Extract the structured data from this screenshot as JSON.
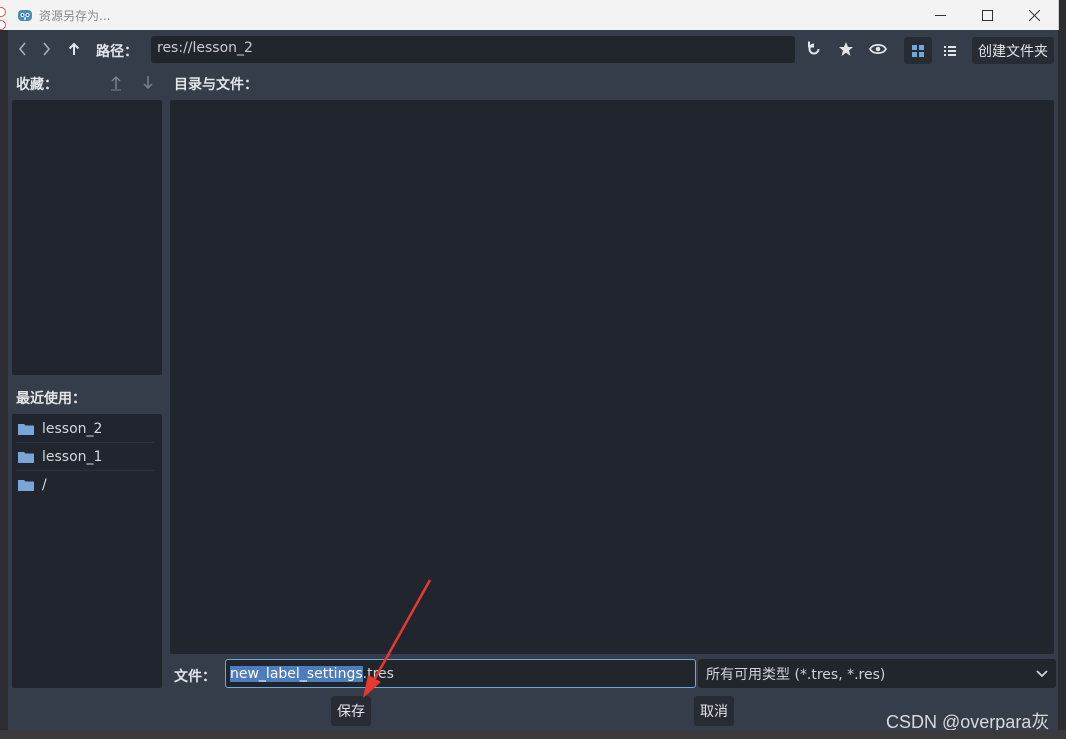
{
  "window": {
    "title": "资源另存为..."
  },
  "toolbar": {
    "path_label": "路径：",
    "path_value": "res://lesson_2",
    "create_folder_label": "创建文件夹"
  },
  "favorites": {
    "label": "收藏："
  },
  "directory": {
    "label": "目录与文件："
  },
  "recent": {
    "label": "最近使用：",
    "items": [
      {
        "label": "lesson_2"
      },
      {
        "label": "lesson_1"
      },
      {
        "label": "/"
      }
    ]
  },
  "file": {
    "label": "文件：",
    "name_selected": "new_label_settings",
    "name_rest": ".tres",
    "filter": "所有可用类型 (*.tres, *.res)"
  },
  "buttons": {
    "save_label": "保存",
    "cancel_label": "取消"
  },
  "watermark": "CSDN @overpara灰",
  "colors": {
    "accent": "#6fa8dc",
    "selection": "#4d7dbd",
    "annotation_arrow": "#e8382f"
  }
}
